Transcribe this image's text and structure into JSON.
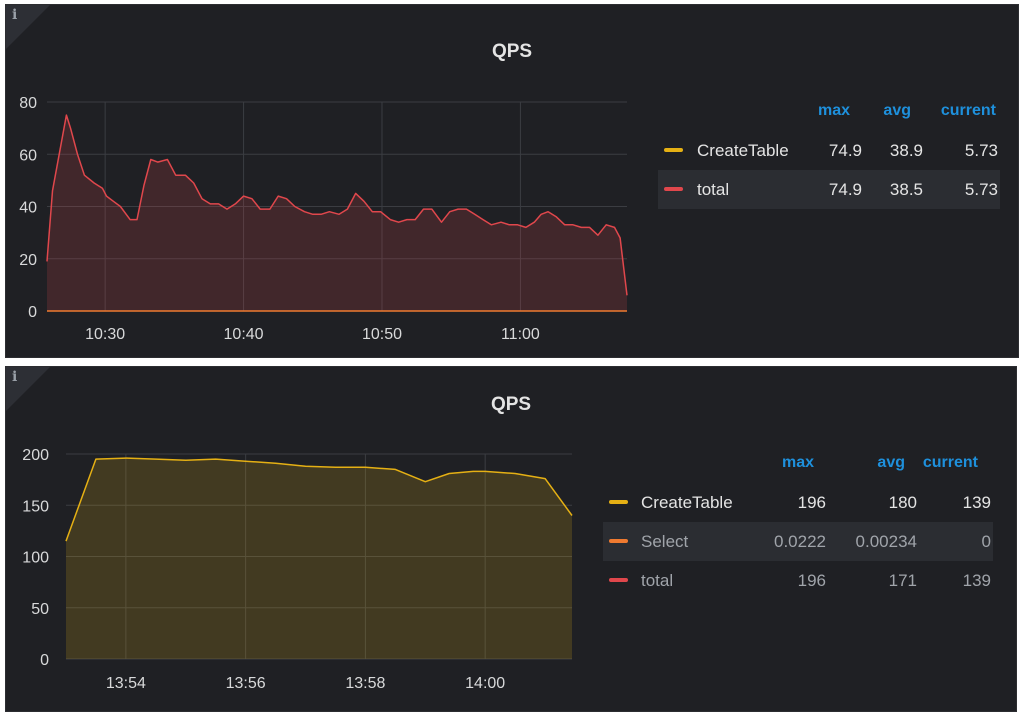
{
  "panels": [
    {
      "title": "QPS",
      "info_icon": "i",
      "legend": {
        "headers": [
          "max",
          "avg",
          "current"
        ],
        "rows": [
          {
            "name": "CreateTable",
            "color": "#e5b014",
            "max": "74.9",
            "avg": "38.9",
            "current": "5.73"
          },
          {
            "name": "total",
            "color": "#e0474c",
            "max": "74.9",
            "avg": "38.5",
            "current": "5.73"
          }
        ]
      }
    },
    {
      "title": "QPS",
      "info_icon": "i",
      "legend": {
        "headers": [
          "max",
          "avg",
          "current"
        ],
        "rows": [
          {
            "name": "CreateTable",
            "color": "#e5b014",
            "max": "196",
            "avg": "180",
            "current": "139"
          },
          {
            "name": "Select",
            "color": "#ef7a30",
            "max": "0.0222",
            "avg": "0.00234",
            "current": "0"
          },
          {
            "name": "total",
            "color": "#e0474c",
            "max": "196",
            "avg": "171",
            "current": "139"
          }
        ]
      }
    }
  ],
  "chart_data": [
    {
      "type": "area",
      "title": "QPS",
      "x_ticks": [
        "10:30",
        "10:40",
        "10:50",
        "11:00"
      ],
      "x_tick_minutes": [
        30,
        40,
        50,
        60
      ],
      "xlim_minutes": [
        25.8,
        67.7
      ],
      "y_ticks": [
        0,
        20,
        40,
        60,
        80
      ],
      "ylim": [
        0,
        80
      ],
      "grid": true,
      "legend_position": "right",
      "series": [
        {
          "name": "total",
          "color": "#e0474c",
          "fill": true,
          "x": [
            25.8,
            26.2,
            27.2,
            27.5,
            28.0,
            28.5,
            29.2,
            29.8,
            30.1,
            30.6,
            31.1,
            31.8,
            32.3,
            32.8,
            33.3,
            33.8,
            34.5,
            35.1,
            35.8,
            36.4,
            37.0,
            37.6,
            38.2,
            38.8,
            39.4,
            40.0,
            40.6,
            41.2,
            41.9,
            42.5,
            43.1,
            43.7,
            44.4,
            45.0,
            45.6,
            46.2,
            46.9,
            47.5,
            48.1,
            48.7,
            49.3,
            49.9,
            50.6,
            51.2,
            51.8,
            52.4,
            53.0,
            53.6,
            54.3,
            54.9,
            55.5,
            56.1,
            56.7,
            57.3,
            57.9,
            58.6,
            59.2,
            59.8,
            60.4,
            61.0,
            61.5,
            62.0,
            62.6,
            63.2,
            63.8,
            64.4,
            65.0,
            65.6,
            66.2,
            66.8,
            67.2,
            67.7
          ],
          "y": [
            19,
            46,
            75,
            70,
            60,
            52,
            49,
            47,
            44,
            42,
            40,
            35,
            35,
            48,
            58,
            57,
            58,
            52,
            52,
            49,
            43,
            41,
            41,
            39,
            41,
            44,
            43,
            39,
            39,
            44,
            43,
            40,
            38,
            37,
            37,
            38,
            37,
            39,
            45,
            42,
            38,
            38,
            35,
            34,
            35,
            35,
            39,
            39,
            34,
            38,
            39,
            39,
            37,
            35,
            33,
            34,
            33,
            33,
            32,
            34,
            37,
            38,
            36,
            33,
            33,
            32,
            32,
            29,
            33,
            32,
            28,
            6
          ]
        },
        {
          "name": "CreateTable",
          "color": "#ef7a30",
          "fill": false,
          "x": [
            25.8,
            67.7
          ],
          "y": [
            0,
            0
          ]
        }
      ]
    },
    {
      "type": "area",
      "title": "QPS",
      "x_ticks": [
        "13:54",
        "13:56",
        "13:58",
        "14:00"
      ],
      "x_tick_minutes": [
        834,
        836,
        838,
        840
      ],
      "xlim_minutes": [
        833.0,
        841.45
      ],
      "y_ticks": [
        0,
        50,
        100,
        150,
        200
      ],
      "ylim": [
        0,
        200
      ],
      "grid": true,
      "legend_position": "right",
      "series": [
        {
          "name": "CreateTable",
          "color": "#e5b014",
          "fill": true,
          "x": [
            833.0,
            833.5,
            834.0,
            834.5,
            835.0,
            835.5,
            836.0,
            836.5,
            837.0,
            837.5,
            838.0,
            838.5,
            839.0,
            839.4,
            839.8,
            840.0,
            840.5,
            841.0,
            841.45
          ],
          "y": [
            115,
            195,
            196,
            195,
            194,
            195,
            193,
            191,
            188,
            187,
            187,
            185,
            173,
            181,
            183,
            183,
            181,
            176,
            140
          ]
        }
      ]
    }
  ]
}
